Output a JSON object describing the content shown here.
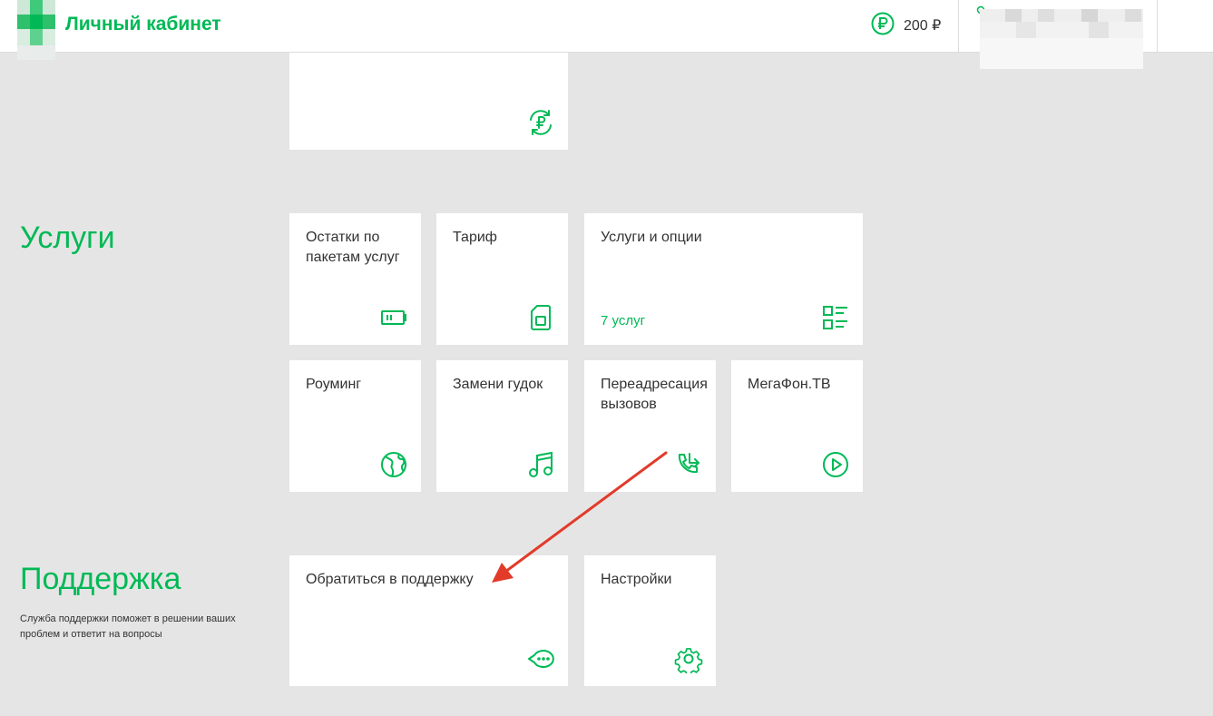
{
  "header": {
    "app_title": "Личный кабинет",
    "balance": "200 ₽",
    "balance_icon": "ruble-circle-icon",
    "user_icon": "user-icon",
    "accent_color": "#00b956"
  },
  "top_tile": {
    "icon": "ruble-refresh-icon"
  },
  "services": {
    "title": "Услуги",
    "tiles": [
      {
        "label": "Остатки по пакетам услуг",
        "icon": "battery-icon"
      },
      {
        "label": "Тариф",
        "icon": "sim-card-icon"
      },
      {
        "label": "Услуги и опции",
        "sub": "7 услуг",
        "icon": "options-list-icon"
      },
      {
        "label": "Роуминг",
        "icon": "globe-icon"
      },
      {
        "label": "Замени гудок",
        "icon": "music-note-icon"
      },
      {
        "label": "Переадресация вызовов",
        "icon": "call-forward-icon"
      },
      {
        "label": "МегаФон.ТВ",
        "icon": "play-icon"
      }
    ]
  },
  "support": {
    "title": "Поддержка",
    "description": "Служба поддержки поможет в решении ваших проблем и ответит на вопросы",
    "tiles": [
      {
        "label": "Обратиться в поддержку",
        "icon": "chat-bubble-icon"
      },
      {
        "label": "Настройки",
        "icon": "gear-icon"
      }
    ]
  },
  "annotation": {
    "color": "#e23b2a"
  }
}
